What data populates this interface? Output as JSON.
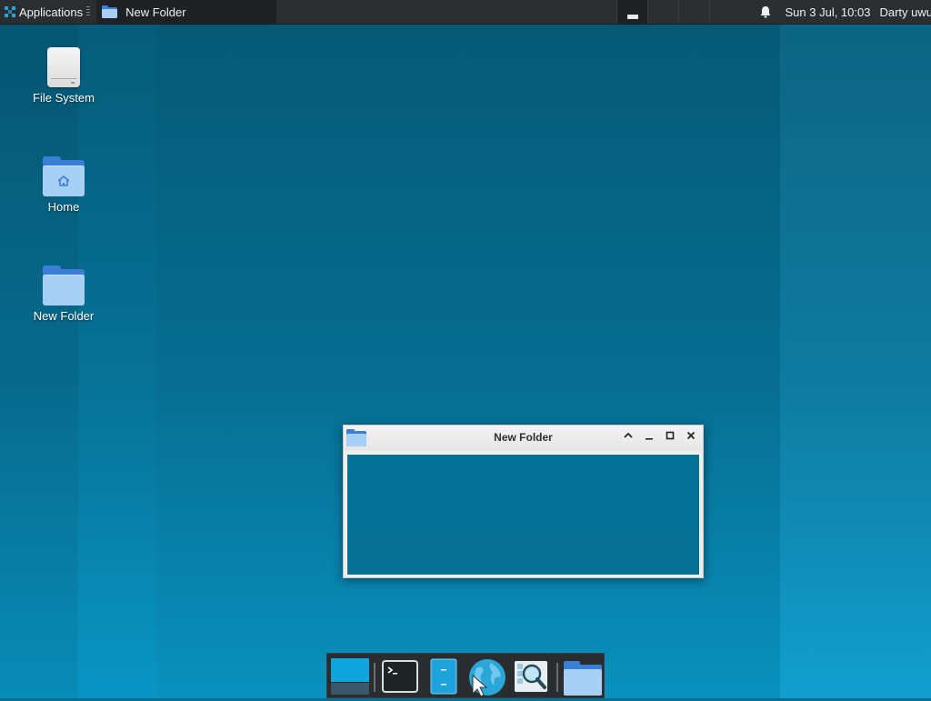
{
  "panel": {
    "applications_label": "Applications",
    "task_title": "New Folder",
    "clock": "Sun  3 Jul, 10:03",
    "user": "Darty uwu",
    "icons": [
      "xfce-mouse-icon",
      "folder-icon",
      "bell-icon"
    ]
  },
  "desktop": {
    "icons": [
      {
        "label": "File System",
        "icon": "drive-icon"
      },
      {
        "label": "Home",
        "icon": "home-folder-icon"
      },
      {
        "label": "New Folder",
        "icon": "folder-icon"
      }
    ]
  },
  "window": {
    "title": "New Folder",
    "buttons": [
      "shade",
      "minimize",
      "maximize",
      "close"
    ]
  },
  "dock": {
    "items": [
      "show-desktop",
      "terminal",
      "file-manager",
      "web-browser",
      "app-finder",
      "folder"
    ]
  },
  "colors": {
    "desktop_bg": "#0b6e93",
    "panel_bg": "#2b2e30",
    "accent": "#27a3d8"
  }
}
